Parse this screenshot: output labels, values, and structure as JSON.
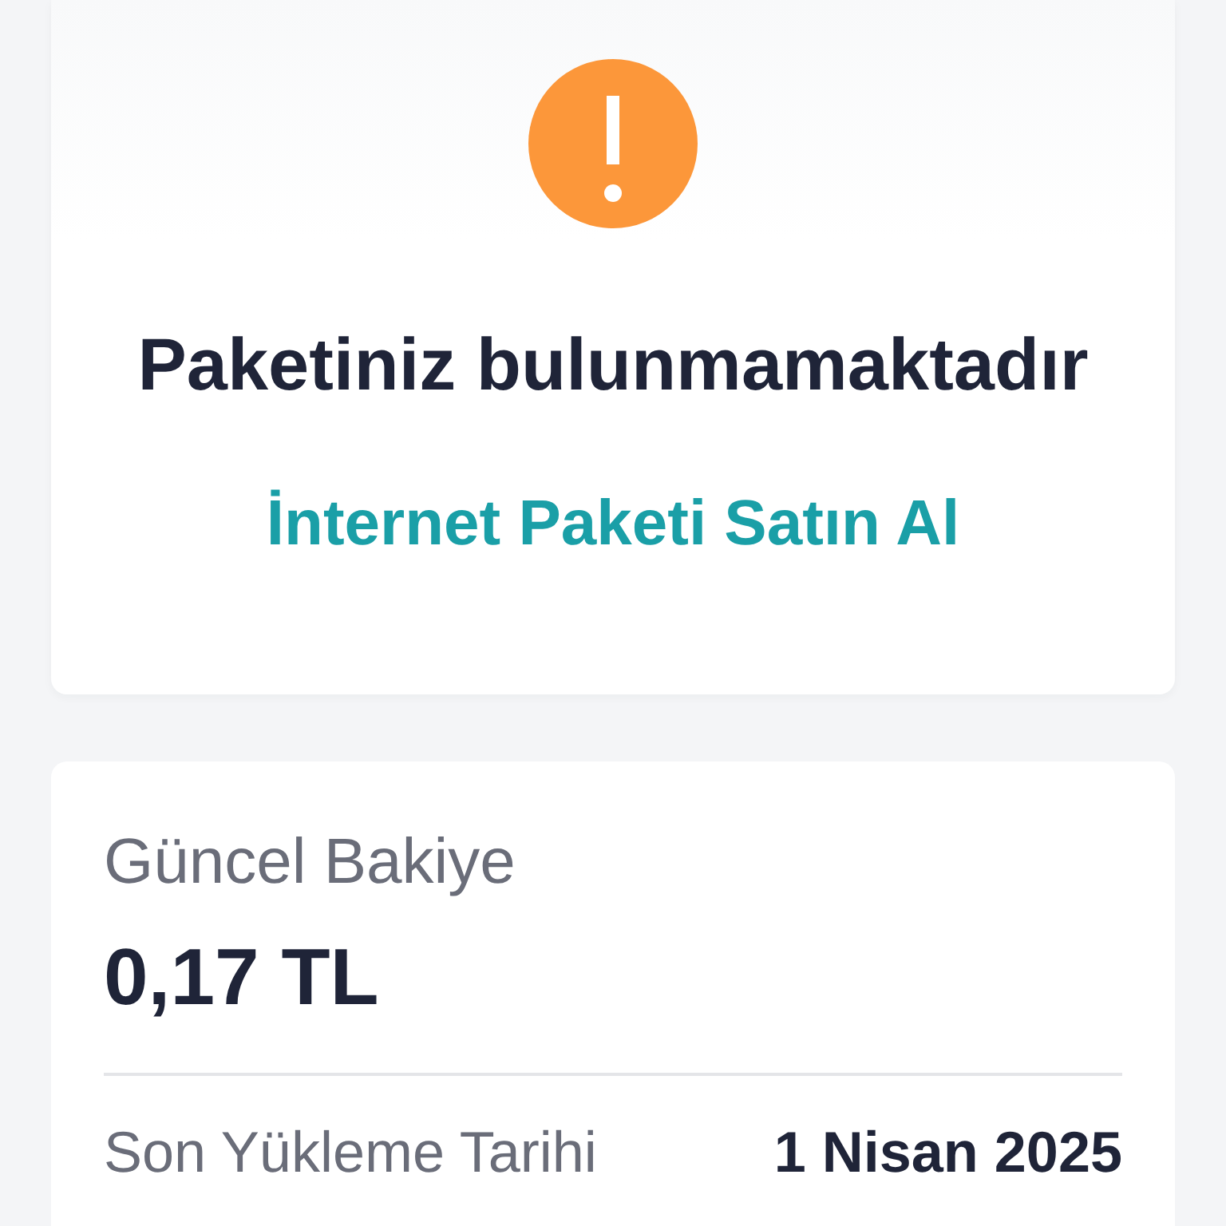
{
  "package_card": {
    "title": "Paketiniz bulunmamaktadır",
    "link": "İnternet Paketi Satın Al"
  },
  "balance_card": {
    "label": "Güncel Bakiye",
    "amount": "0,17 TL",
    "rows": [
      {
        "label": "Son Yükleme Tarihi",
        "value": "1 Nisan 2025"
      }
    ]
  }
}
